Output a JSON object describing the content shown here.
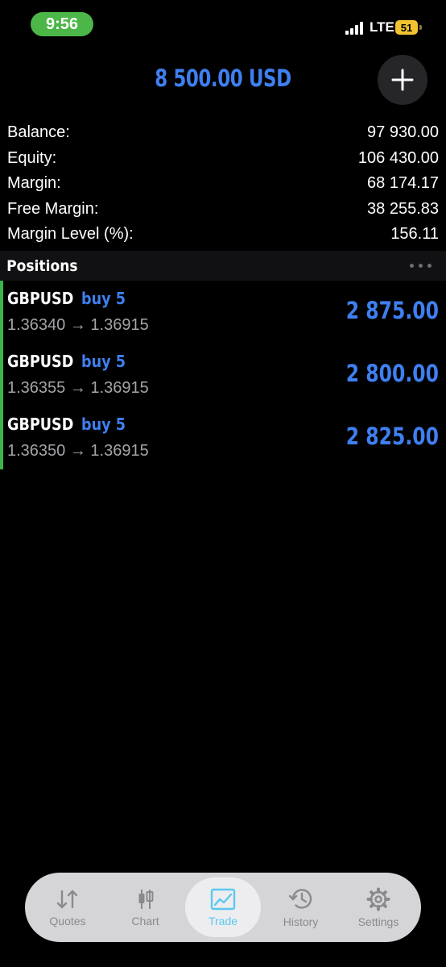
{
  "status_bar": {
    "time": "9:56",
    "network": "LTE",
    "battery": "51"
  },
  "header": {
    "total": "8 500.00 USD",
    "add_icon": "plus-icon"
  },
  "summary": [
    {
      "label": "Balance:",
      "value": "97 930.00"
    },
    {
      "label": "Equity:",
      "value": "106 430.00"
    },
    {
      "label": "Margin:",
      "value": "68 174.17"
    },
    {
      "label": "Free Margin:",
      "value": "38 255.83"
    },
    {
      "label": "Margin Level (%):",
      "value": "156.11"
    }
  ],
  "positions": {
    "title": "Positions",
    "items": [
      {
        "symbol": "GBPUSD",
        "type": "buy 5",
        "prices": "1.36340 → 1.36915",
        "profit": "2 875.00"
      },
      {
        "symbol": "GBPUSD",
        "type": "buy 5",
        "prices": "1.36355 → 1.36915",
        "profit": "2 800.00"
      },
      {
        "symbol": "GBPUSD",
        "type": "buy 5",
        "prices": "1.36350 → 1.36915",
        "profit": "2 825.00"
      }
    ]
  },
  "tabs": [
    {
      "label": "Quotes",
      "icon": "quotes-arrows-icon"
    },
    {
      "label": "Chart",
      "icon": "candlestick-icon"
    },
    {
      "label": "Trade",
      "icon": "trade-chart-icon",
      "active": true
    },
    {
      "label": "History",
      "icon": "history-clock-icon"
    },
    {
      "label": "Settings",
      "icon": "gear-icon"
    }
  ],
  "colors": {
    "accent": "#3f7ff0",
    "active_tab": "#5ac8f0",
    "position_bar": "#3cb54a",
    "time_pill": "#4cb648"
  }
}
